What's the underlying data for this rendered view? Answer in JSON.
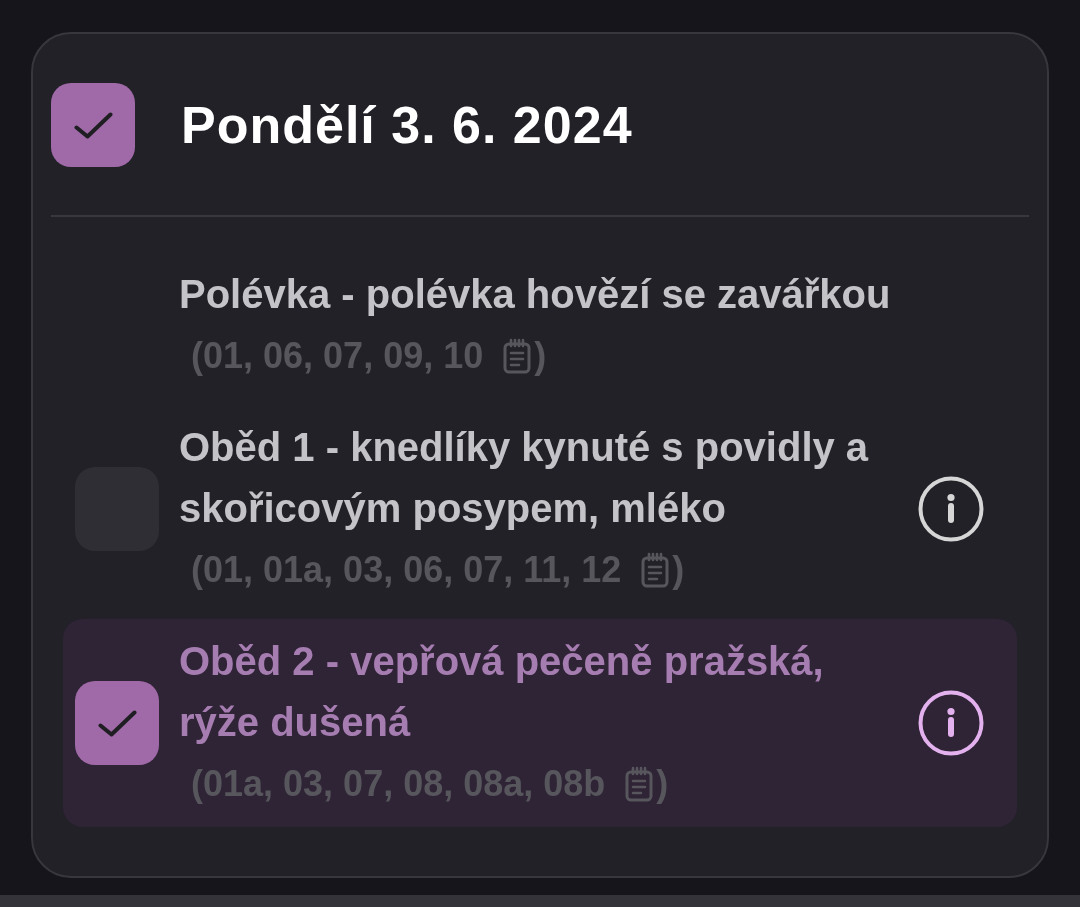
{
  "day": {
    "title": "Pondělí 3. 6. 2024",
    "checked": true
  },
  "meals": [
    {
      "kind": "plain",
      "checked": false,
      "name": "Polévka - polévka hovězí se zavářkou",
      "allergens": {
        "codes": "(01, 06, 07, 09, 10",
        "close": ")"
      }
    },
    {
      "kind": "selectable",
      "checked": false,
      "name": "Oběd 1 - knedlíky kynuté s povidly a skořicovým posypem, mléko",
      "allergens": {
        "codes": "(01, 01a, 03, 06, 07, 11, 12",
        "close": ")"
      }
    },
    {
      "kind": "selectable",
      "checked": true,
      "name": "Oběd 2 - vepřová pečeně pražská, rýže dušená",
      "allergens": {
        "codes": "(01a, 03, 07, 08, 08a, 08b",
        "close": ")"
      }
    }
  ]
}
